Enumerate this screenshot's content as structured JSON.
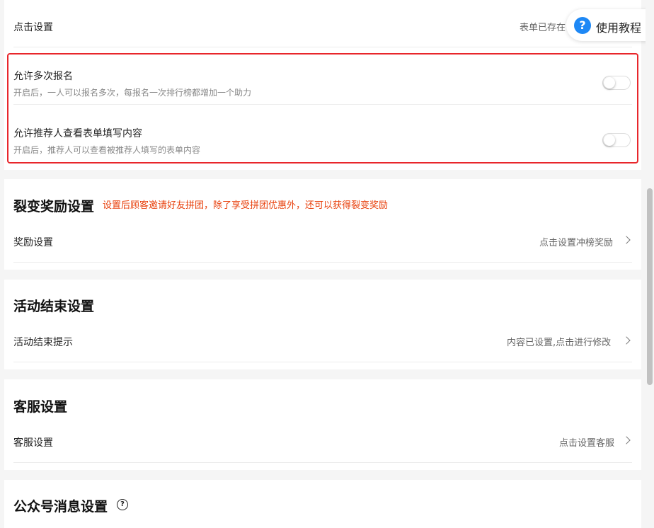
{
  "top": {
    "click_settings_label": "点击设置",
    "form_status_text": "表单已存在"
  },
  "tutorial": {
    "icon": "?",
    "label": "使用教程"
  },
  "options": [
    {
      "label": "允许多次报名",
      "desc": "开启后，一人可以报名多次，每报名一次排行榜都增加一个助力",
      "enabled": false
    },
    {
      "label": "允许推荐人查看表单填写内容",
      "desc": "开启后，推荐人可以查看被推荐人填写的表单内容",
      "enabled": false
    }
  ],
  "reward": {
    "title": "裂变奖励设置",
    "hint": "设置后顾客邀请好友拼团，除了享受拼团优惠外，还可以获得裂变奖励",
    "row_label": "奖励设置",
    "row_value": "点击设置冲榜奖励"
  },
  "end": {
    "title": "活动结束设置",
    "row_label": "活动结束提示",
    "row_value": "内容已设置,点击进行修改"
  },
  "service": {
    "title": "客服设置",
    "row_label": "客服设置",
    "row_value": "点击设置客服"
  },
  "wechat": {
    "title": "公众号消息设置",
    "help_icon": "?"
  },
  "colors": {
    "highlight_border": "#e8262b",
    "hint_text": "#e8400c",
    "tutorial_icon": "#1e88f5"
  }
}
